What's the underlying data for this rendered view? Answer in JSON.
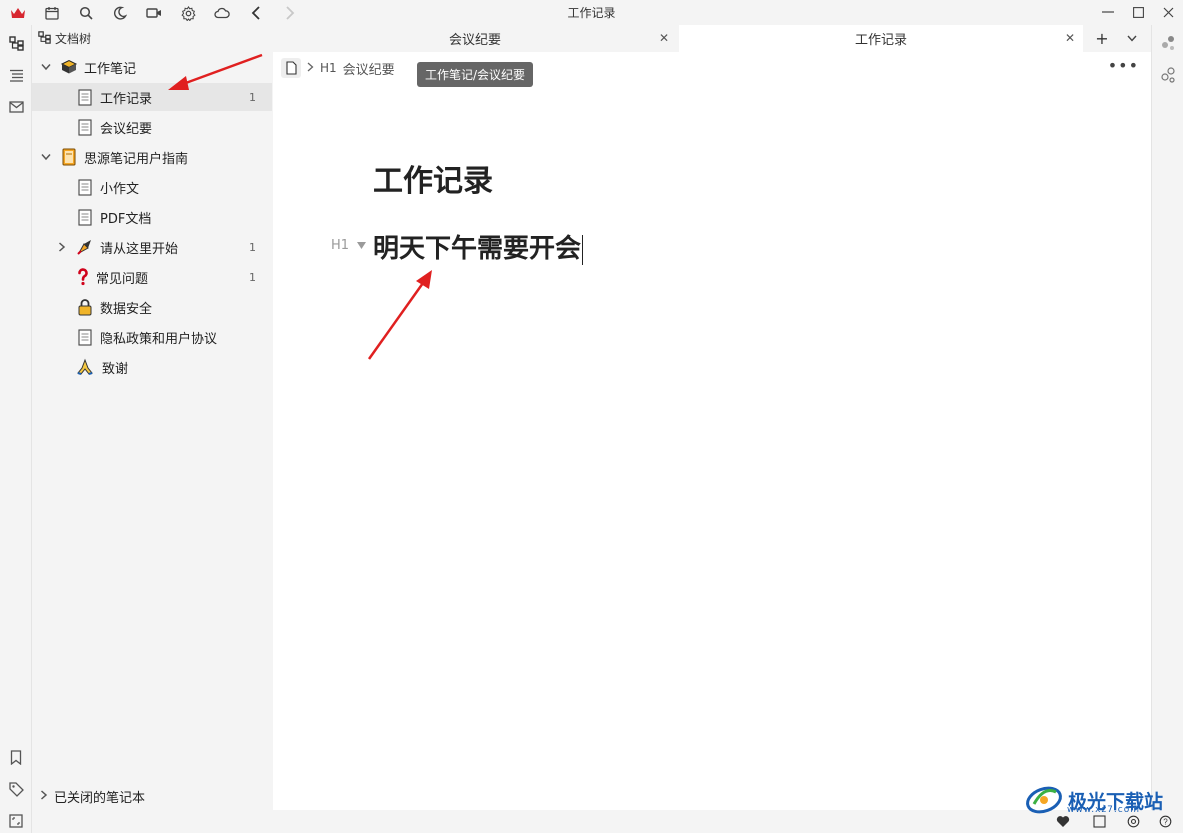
{
  "window": {
    "title": "工作记录"
  },
  "titlebar_icons": [
    "crown-icon",
    "calendar-icon",
    "search-icon",
    "moon-icon",
    "video-icon",
    "gear-icon",
    "cloud-icon",
    "back-icon",
    "forward-icon"
  ],
  "sidebar": {
    "header": "文档树",
    "items": [
      {
        "label": "工作笔记",
        "icon": "notebook-icon",
        "level": 0,
        "expanded": true,
        "count": ""
      },
      {
        "label": "工作记录",
        "icon": "doc-icon",
        "level": 1,
        "selected": true,
        "count": "1"
      },
      {
        "label": "会议纪要",
        "icon": "doc-icon",
        "level": 1,
        "count": ""
      },
      {
        "label": "思源笔记用户指南",
        "icon": "book-icon",
        "level": 0,
        "expanded": true,
        "count": ""
      },
      {
        "label": "小作文",
        "icon": "doc-icon",
        "level": 1,
        "count": ""
      },
      {
        "label": "PDF文档",
        "icon": "doc-icon",
        "level": 1,
        "count": ""
      },
      {
        "label": "请从这里开始",
        "icon": "rocket-icon",
        "level": 1,
        "collapsed": true,
        "count": "1"
      },
      {
        "label": "常见问题",
        "icon": "question-icon",
        "level": 1,
        "count": "1"
      },
      {
        "label": "数据安全",
        "icon": "lock-icon",
        "level": 1,
        "count": ""
      },
      {
        "label": "隐私政策和用户协议",
        "icon": "doc-icon",
        "level": 1,
        "count": ""
      },
      {
        "label": "致谢",
        "icon": "pray-icon",
        "level": 1,
        "count": ""
      }
    ],
    "closed_notebooks": "已关闭的笔记本"
  },
  "tabs": [
    {
      "label": "会议纪要",
      "active": false
    },
    {
      "label": "工作记录",
      "active": true
    }
  ],
  "breadcrumb": {
    "heading_marker": "H1",
    "label": "会议纪要",
    "tooltip": "工作笔记/会议纪要"
  },
  "editor": {
    "title": "工作记录",
    "blocks": [
      {
        "type": "h1",
        "marker": "H1",
        "text": "明天下午需要开会"
      }
    ]
  },
  "watermark": {
    "text": "极光下载站",
    "sub": "www.xz7.com"
  },
  "colors": {
    "annotation_arrow": "#e02020",
    "tooltip_bg": "#666666",
    "selected_row": "#e6e6e6"
  }
}
